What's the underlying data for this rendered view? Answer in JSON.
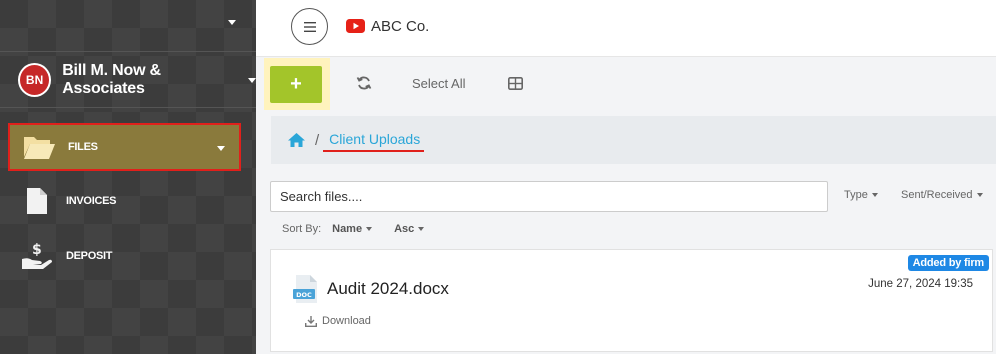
{
  "header": {
    "brand_name": "ABC Co.",
    "menu_icon": "hamburger-icon",
    "brand_icon": "youtube-icon"
  },
  "sidebar": {
    "account": {
      "initials": "BN",
      "name": "Bill M. Now & Associates"
    },
    "items": [
      {
        "label": "FILES",
        "icon": "folder-open-icon",
        "active": true
      },
      {
        "label": "INVOICES",
        "icon": "document-icon",
        "active": false
      },
      {
        "label": "DEPOSIT",
        "icon": "hand-dollar-icon",
        "active": false
      }
    ]
  },
  "toolbar": {
    "add_label": "+",
    "refresh_icon": "refresh-icon",
    "select_all_label": "Select All",
    "view_icon": "grid-view-icon"
  },
  "breadcrumb": {
    "home_icon": "home-icon",
    "separator": "/",
    "current": "Client Uploads"
  },
  "search": {
    "placeholder": "Search files...."
  },
  "filters": {
    "type_label": "Type",
    "sent_received_label": "Sent/Received"
  },
  "sort": {
    "label": "Sort By:",
    "field": "Name",
    "order": "Asc"
  },
  "files": [
    {
      "name": "Audit 2024.docx",
      "date": "June 27, 2024 19:35",
      "badge": "Added by firm",
      "download_label": "Download",
      "icon_text": "DOC"
    }
  ],
  "colors": {
    "accent_green": "#a3c52a",
    "link_blue": "#2aa6d8",
    "badge_blue": "#1e88e5",
    "highlight_red": "#e0201b",
    "avatar_red": "#c62828"
  }
}
